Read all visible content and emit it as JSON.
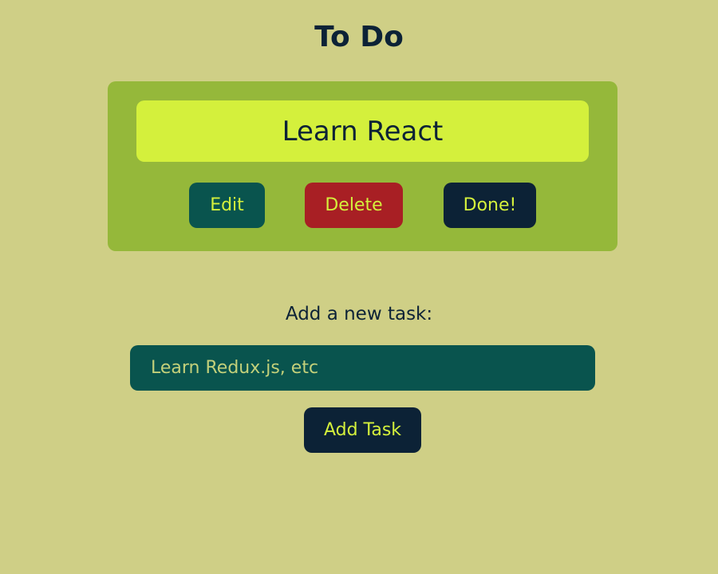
{
  "header": {
    "title": "To Do"
  },
  "task": {
    "text": "Learn React",
    "edit_label": "Edit",
    "delete_label": "Delete",
    "done_label": "Done!"
  },
  "new_task": {
    "label": "Add a new task:",
    "input_value": "",
    "input_placeholder": "Learn Redux.js, etc",
    "add_label": "Add Task"
  },
  "colors": {
    "background": "#cfcf86",
    "card": "#95b83a",
    "task_highlight": "#d4f03c",
    "edit": "#09544e",
    "delete": "#a81f24",
    "dark": "#0c2236"
  }
}
